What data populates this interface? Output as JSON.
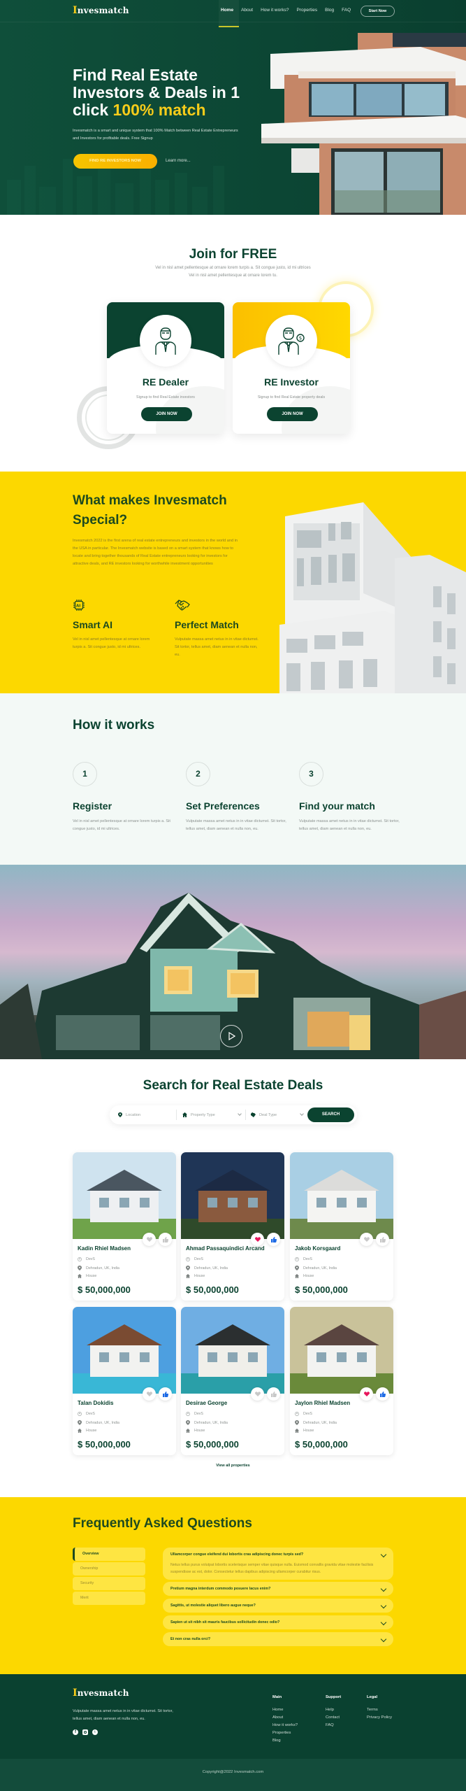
{
  "brand": {
    "logo_initial": "I",
    "logo_rest": "nvesmatch",
    "primary": "#0b4330",
    "accent": "#fcd800"
  },
  "nav": {
    "items": [
      {
        "label": "Home",
        "active": true
      },
      {
        "label": "About"
      },
      {
        "label": "How it works?"
      },
      {
        "label": "Properties"
      },
      {
        "label": "Blog"
      },
      {
        "label": "FAQ"
      }
    ],
    "cta": "Start Now"
  },
  "hero": {
    "title_line1": "Find Real Estate",
    "title_line2": "Investors & Deals in 1",
    "title_line3_plain": "click ",
    "title_line3_highlight": "100% match",
    "subtitle": "Invesmatch is a smart and unique system that 100% Match between Real Estate Entrepreneurs and Investors for profitable deals. Free Signup",
    "primary_button": "FIND RE INVESTORS NOW",
    "secondary_link": "Learn more..."
  },
  "join": {
    "title": "Join for FREE",
    "subtitle_line1": "Vel in nisl amet pellentesque at ornare lorem turpis a. Sit congue justo, id mi ultrices",
    "subtitle_line2": "Vel in nisl amet pellentesque at ornare lorem tu.",
    "cards": [
      {
        "title": "RE Dealer",
        "text": "Signup to find Real Estate investors",
        "button": "JOIN NOW",
        "icon": "dealer-person-icon"
      },
      {
        "title": "RE Investor",
        "text": "Signup to find Real Estate property deals",
        "button": "JOIN NOW",
        "icon": "investor-person-dollar-icon"
      }
    ]
  },
  "special": {
    "title": "What makes Invesmatch Special?",
    "text": "Invesmatch 2022 is the first arena of real estate entrepreneurs and investors in the world and in the USA in particular. The Invesmatch website is based on a smart system that knows how to locate and bring together thousands of Real Estate entrepreneurs looking for investors for attractive deals, and RE investors looking for worthwhile investment opportunities",
    "features": [
      {
        "title": "Smart AI",
        "text": "Vel in nisl amet pellentesque at ornare lorem turpis a. Sit congue justo, id mi ultrices.",
        "icon": "ai-chip-icon"
      },
      {
        "title": "Perfect Match",
        "text": "Vulputate massa amet netus in in vitae dictumst. Sit tortor, tellus amet, diam aenean et nulla non, eu.",
        "icon": "handshake-icon"
      }
    ]
  },
  "how": {
    "title": "How it works",
    "steps": [
      {
        "num": "1",
        "title": "Register",
        "text": "Vel in nisl amet pellentesque at ornare lorem turpis a. Sit congue justo, id mi ultrices."
      },
      {
        "num": "2",
        "title": "Set Preferences",
        "text": "Vulputate massa amet netus in in vitae dictumst. Sit tortor, tellus amet, diam aenean et nulla non, eu."
      },
      {
        "num": "3",
        "title": "Find your match",
        "text": "Vulputate massa amet netus in in vitae dictumst. Sit tortor, tellus amet, diam aenean et nulla non, eu."
      }
    ]
  },
  "video": {
    "play_icon": "play-icon"
  },
  "search": {
    "title": "Search for Real Estate Deals",
    "location_placeholder": "Location",
    "property_type": "Property Type",
    "deal_type": "Deal Type",
    "button": "SEARCH"
  },
  "properties": [
    {
      "name": "Kadin Rhiel Madsen",
      "owner": "DevS",
      "location": "Dehradun, UK, India",
      "type": "House",
      "price": "$ 50,000,000",
      "liked": false,
      "thumbs": false
    },
    {
      "name": "Ahmad Passaquindici Arcand",
      "owner": "DevS",
      "location": "Dehradun, UK, India",
      "type": "House",
      "price": "$ 50,000,000",
      "liked": true,
      "thumbs": true
    },
    {
      "name": "Jakob Korsgaard",
      "owner": "DevS",
      "location": "Dehradun, UK, India",
      "type": "House",
      "price": "$ 50,000,000",
      "liked": false,
      "thumbs": false
    },
    {
      "name": "Talan Dokidis",
      "owner": "DevS",
      "location": "Dehradun, UK, India",
      "type": "House",
      "price": "$ 50,000,000",
      "liked": false,
      "thumbs": true
    },
    {
      "name": "Desirae George",
      "owner": "DevS",
      "location": "Dehradun, UK, India",
      "type": "House",
      "price": "$ 50,000,000",
      "liked": false,
      "thumbs": false
    },
    {
      "name": "Jaylon Rhiel Madsen",
      "owner": "DevS",
      "location": "Dehradun, UK, India",
      "type": "House",
      "price": "$ 50,000,000",
      "liked": true,
      "thumbs": true
    }
  ],
  "view_all": "View all properties",
  "faq": {
    "title": "Frequently Asked Questions",
    "tabs": [
      "Overview",
      "Ownership",
      "Security",
      "Merit"
    ],
    "active_tab": "Overview",
    "items": [
      {
        "q": "Ullamcorper congue eleifend dui lobortis cras adipiscing donec turpis sed?",
        "a": "Netus tellus purus volutpat lobortis scelerisque semper vitae quisque nulla. Euismod convallis gravida vitae molestie facilisis suspendisse ac est, dolor. Consectetur tellus dapibus adipiscing ullamcorper curabitur risus.",
        "open": true
      },
      {
        "q": "Pretium magna interdum commodo posuere lacus enim?"
      },
      {
        "q": "Sagittis, ut molestie aliquet libero augue neque?"
      },
      {
        "q": "Sapien ut sit nibh sit mauris faucibus sollicitudin donec odio?"
      },
      {
        "q": "Et non cras nulla orci?"
      }
    ]
  },
  "footer": {
    "text": "Vulputate massa amet netus in in vitae dictumst. Sit tortor, tellus amet, diam aenean et nulla non, eu.",
    "social": [
      "facebook-icon",
      "instagram-icon",
      "twitter-icon"
    ],
    "columns": [
      {
        "title": "Main",
        "links": [
          "Home",
          "About",
          "How it works?",
          "Properties",
          "Blog"
        ]
      },
      {
        "title": "Support",
        "links": [
          "Help",
          "Contact",
          "FAQ"
        ]
      },
      {
        "title": "Legal",
        "links": [
          "Terms",
          "Privacy Policy"
        ]
      }
    ],
    "copyright": "Copyright@2022 Invesmatch.com"
  }
}
